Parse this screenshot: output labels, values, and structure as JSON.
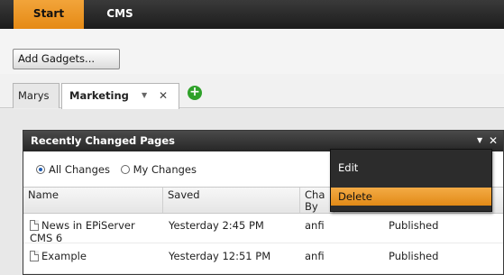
{
  "topnav": {
    "tabs": [
      {
        "label": "Start",
        "active": true
      },
      {
        "label": "CMS",
        "active": false
      }
    ]
  },
  "toolbar": {
    "add_gadgets_label": "Add Gadgets..."
  },
  "dashboard_tabs": [
    {
      "label": "Marys"
    },
    {
      "label": "Marketing",
      "menu_icon": "chevron-down-icon",
      "close_icon": "close-icon"
    }
  ],
  "add_tab_icon": "plus-circle-icon",
  "gadget": {
    "title": "Recently Changed Pages",
    "radios": [
      {
        "label": "All Changes",
        "selected": true
      },
      {
        "label": "My Changes",
        "selected": false
      }
    ],
    "columns": [
      "Name",
      "Saved",
      "Cha By",
      ""
    ],
    "rows": [
      {
        "name": "News in EPiServer CMS 6",
        "saved": "Yesterday 2:45 PM",
        "by": "anfi",
        "status": "Published"
      },
      {
        "name": "Example",
        "saved": "Yesterday 12:51 PM",
        "by": "anfi",
        "status": "Published"
      }
    ]
  },
  "context_menu": {
    "items": [
      {
        "label": "Edit"
      },
      {
        "label": "Delete",
        "highlighted": true
      }
    ]
  },
  "colors": {
    "accent": "#e58a15",
    "header_dark": "#262626",
    "add_green": "#2fa12a"
  }
}
